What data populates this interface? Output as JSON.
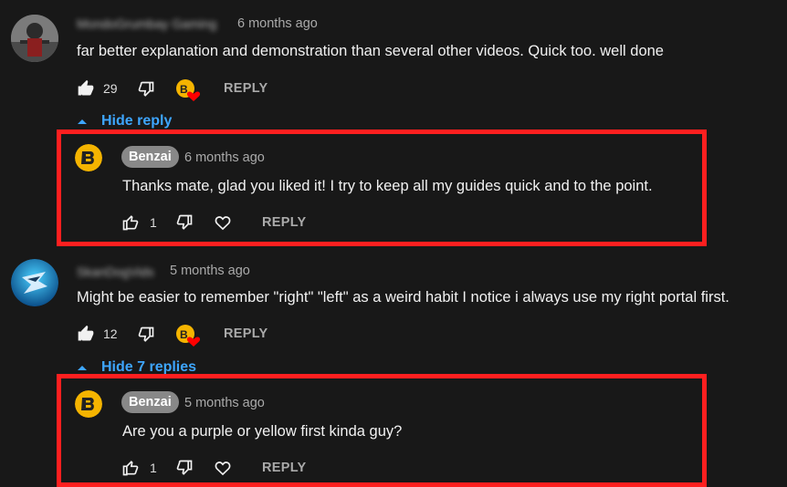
{
  "comment1": {
    "author": "MondoGrumbay Gaming",
    "time": "6 months ago",
    "text": "far better explanation and demonstration than several other videos. Quick too. well done",
    "likes": "29",
    "reply_label": "REPLY",
    "hide_label": "Hide reply"
  },
  "reply1": {
    "author": "Benzai",
    "time": "6 months ago",
    "text": "Thanks mate, glad you liked it! I try to keep all my guides quick and to the point.",
    "likes": "1",
    "reply_label": "REPLY"
  },
  "comment2": {
    "author": "SkanDogVids",
    "time": "5 months ago",
    "text": "Might be easier to remember \"right\" \"left\" as a weird habit I notice i always use my right portal first.",
    "likes": "12",
    "reply_label": "REPLY",
    "hide_label": "Hide 7 replies"
  },
  "reply2": {
    "author": "Benzai",
    "time": "5 months ago",
    "text": "Are you a purple or yellow first kinda guy?",
    "likes": "1",
    "reply_label": "REPLY"
  },
  "colors": {
    "background": "#181818",
    "highlight": "#ff1f1f",
    "link": "#3ea6ff",
    "heart": "#ff0000",
    "benzai_logo": "#f5b400"
  },
  "icons": [
    "thumbs-up-icon",
    "thumbs-down-icon",
    "heart-icon",
    "creator-heart-icon",
    "chevron-up-icon"
  ]
}
